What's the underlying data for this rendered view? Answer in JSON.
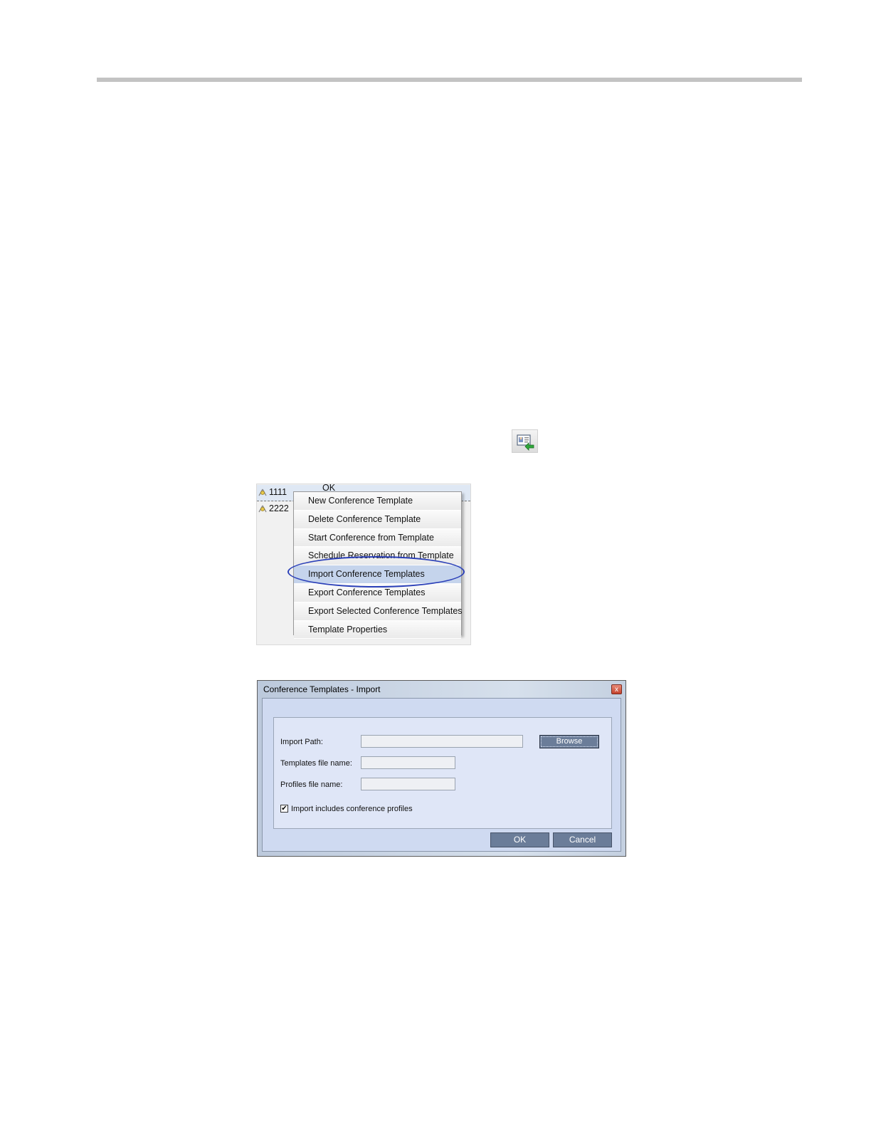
{
  "toolbar_icon": {
    "name": "import-templates-icon"
  },
  "template_list": {
    "rows": [
      {
        "name": "1111",
        "status": "OK"
      },
      {
        "name": "2222",
        "status": ""
      }
    ]
  },
  "context_menu": {
    "items": [
      "New Conference Template",
      "Delete Conference Template",
      "Start Conference from Template",
      "Schedule Reservation from Template",
      "Import Conference Templates",
      "Export Conference Templates",
      "Export Selected Conference Templates",
      "Template Properties"
    ],
    "highlighted": "Import Conference Templates"
  },
  "dialog": {
    "title": "Conference Templates - Import",
    "close_glyph": "x",
    "import_path_label": "Import Path:",
    "import_path_value": "",
    "browse_label": "Browse",
    "templates_file_label": "Templates file name:",
    "templates_file_value": "",
    "profiles_file_label": "Profiles file name:",
    "profiles_file_value": "",
    "include_profiles_label": "Import includes conference profiles",
    "include_profiles_checked": true,
    "ok_label": "OK",
    "cancel_label": "Cancel"
  },
  "colors": {
    "highlight_ellipse": "#2a3fb8",
    "dialog_button": "#6b7d99",
    "dialog_background": "#cfdaf1"
  }
}
